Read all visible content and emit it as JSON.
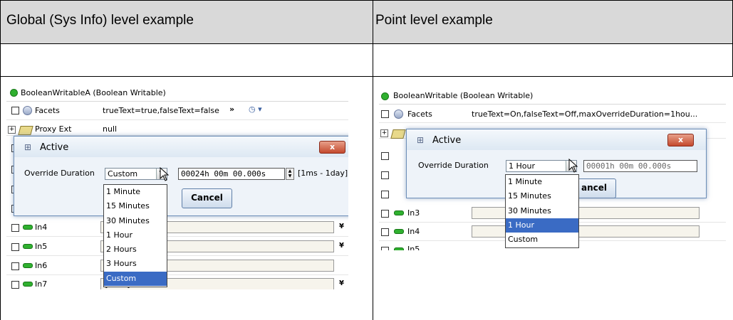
{
  "table": {
    "left_header": "Global (Sys Info) level example",
    "right_header": "Point level example"
  },
  "left_panel": {
    "component": "BooleanWritableA  (Boolean Writable)",
    "facets_label": "Facets",
    "facets_value": "trueText=true,falseText=false",
    "facets_more": "»",
    "proxy_label": "Proxy Ext",
    "proxy_value": "null",
    "rows": [
      {
        "label": "In4"
      },
      {
        "label": "In5"
      },
      {
        "label": "In6"
      },
      {
        "label": "In7",
        "value": "{null}"
      }
    ],
    "dialog": {
      "title": "Active",
      "close": "x",
      "override_label": "Override Duration",
      "combo_value": "Custom",
      "duration_value": "00024h 00m 00.000s",
      "range_hint": "[1ms - 1day]",
      "ok_partial": "",
      "cancel": "Cancel"
    },
    "options": [
      "1 Minute",
      "15 Minutes",
      "30 Minutes",
      "1 Hour",
      "2 Hours",
      "3 Hours",
      "Custom"
    ],
    "selected_option": "Custom"
  },
  "right_panel": {
    "component": "BooleanWritable  (Boolean Writable)",
    "facets_label": "Facets",
    "facets_value": "trueText=On,falseText=Off,maxOverrideDuration=1hou...",
    "rows": [
      {
        "label": "In3"
      },
      {
        "label": "In4"
      },
      {
        "label": "In5"
      }
    ],
    "dialog": {
      "title": "Active",
      "close": "x",
      "override_label": "Override Duration",
      "combo_value": "1 Hour",
      "duration_value": "00001h 00m 00.000s",
      "cancel_partial": "ancel"
    },
    "options": [
      "1 Minute",
      "15 Minutes",
      "30 Minutes",
      "1 Hour",
      "Custom"
    ],
    "selected_option": "1 Hour"
  },
  "colors": {
    "header_bg": "#d9d9d9",
    "dialog_bg": "#eef3f9",
    "selection": "#3a6bc4",
    "close_button": "#c44a2e",
    "status_green": "#2fb02f"
  }
}
